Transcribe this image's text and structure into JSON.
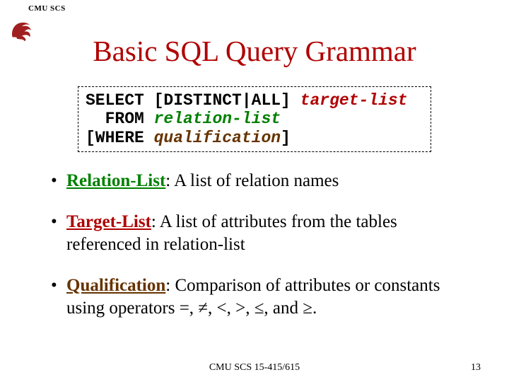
{
  "header": {
    "label": "CMU SCS"
  },
  "title": "Basic SQL Query Grammar",
  "code": {
    "l1a": "SELECT ",
    "l1b": "[DISTINCT|ALL]",
    "l1c": " target-list",
    "l2a": "  FROM ",
    "l2b": "relation-list",
    "l3a": "[WHERE ",
    "l3b": "qualification",
    "l3c": "]"
  },
  "bullets": {
    "b1_term": "Relation-List",
    "b1_rest": ": A list of relation names",
    "b2_term": "Target-List",
    "b2_rest": ": A list of attributes from the tables referenced in relation-list",
    "b3_term": "Qualification",
    "b3_rest": ": Comparison of attributes or constants using operators =, ≠, <, >, ≤, and ≥."
  },
  "footer": {
    "center": "CMU SCS 15-415/615",
    "page": "13"
  }
}
